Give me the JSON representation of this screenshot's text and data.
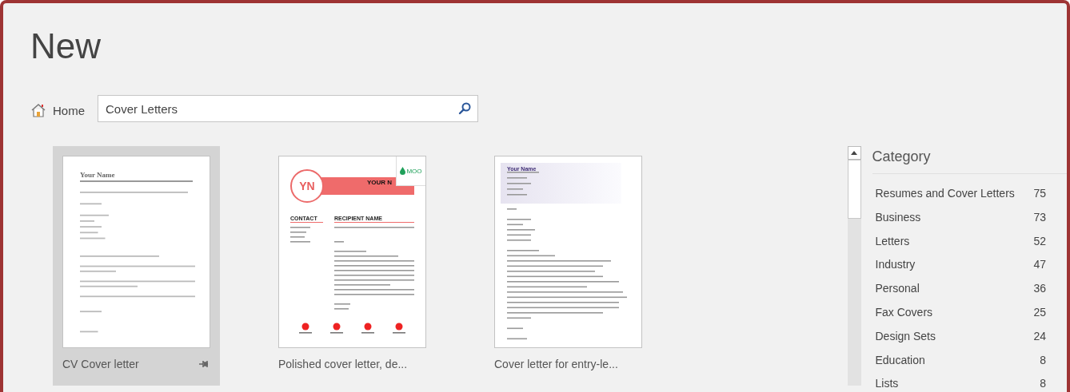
{
  "title": "New",
  "home": {
    "label": "Home"
  },
  "search": {
    "value": "Cover Letters"
  },
  "templates": [
    {
      "kind": "plain",
      "name": "CV Cover letter",
      "selected": true,
      "preview": {
        "heading": "Your Name"
      }
    },
    {
      "kind": "badge",
      "name": "Polished cover letter, de...",
      "selected": false,
      "preview": {
        "initials": "YN",
        "heading": "YOUR N",
        "badge": "MOO",
        "left_heading": "CONTACT",
        "right_heading": "RECIPIENT NAME"
      }
    },
    {
      "kind": "shaded",
      "name": "Cover letter for entry-le...",
      "selected": false,
      "preview": {
        "heading": "Your Name"
      }
    }
  ],
  "category": {
    "heading": "Category",
    "items": [
      {
        "label": "Resumes and Cover Letters",
        "count": "75"
      },
      {
        "label": "Business",
        "count": "73"
      },
      {
        "label": "Letters",
        "count": "52"
      },
      {
        "label": "Industry",
        "count": "47"
      },
      {
        "label": "Personal",
        "count": "36"
      },
      {
        "label": "Fax Covers",
        "count": "25"
      },
      {
        "label": "Design Sets",
        "count": "24"
      },
      {
        "label": "Education",
        "count": "8"
      },
      {
        "label": "Lists",
        "count": "8"
      }
    ]
  }
}
